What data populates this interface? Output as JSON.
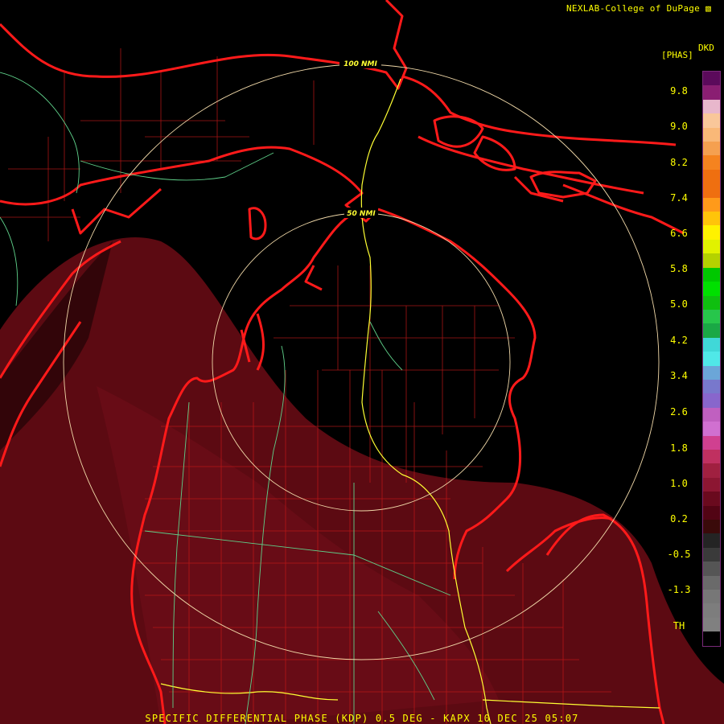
{
  "header": {
    "credit": "NEXLAB-College of DuPage",
    "credit_icon": "nexlab-logo-icon"
  },
  "legend": {
    "unit_label": "[PHAS]",
    "product_code": "DKD",
    "ticks": [
      "9.8",
      "9.0",
      "8.2",
      "7.4",
      "6.6",
      "5.8",
      "5.0",
      "4.2",
      "3.4",
      "2.6",
      "1.8",
      "1.0",
      "0.2",
      "-0.5",
      "-1.3",
      "TH"
    ],
    "colors": [
      "#5b0a5b",
      "#8a1e72",
      "#e8b7cc",
      "#f9c79a",
      "#f9b878",
      "#f5a050",
      "#f5831f",
      "#ef6f10",
      "#ef6f10",
      "#ff9a1a",
      "#ffc40a",
      "#fff200",
      "#e1f200",
      "#b4d200",
      "#00c800",
      "#00e000",
      "#0fbf0f",
      "#27c64b",
      "#1aa845",
      "#40d8d8",
      "#50e8e8",
      "#6ba6d8",
      "#7878cc",
      "#8866cc",
      "#c060c0",
      "#d070d0",
      "#d04090",
      "#c03060",
      "#a02040",
      "#8c1632",
      "#6a0a1e",
      "#520414",
      "#3a0a0a",
      "#242424",
      "#3a3a3a",
      "#555555",
      "#6a6a6a",
      "#777777",
      "#7d7d7d",
      "#808080",
      "#000000"
    ]
  },
  "rings": [
    {
      "label": "100 NMI"
    },
    {
      "label": "50 NMI"
    }
  ],
  "footer": {
    "caption": "SPECIFIC DIFFERENTIAL PHASE (KDP) 0.5 DEG - KAPX 10 DEC 25 05:07"
  }
}
